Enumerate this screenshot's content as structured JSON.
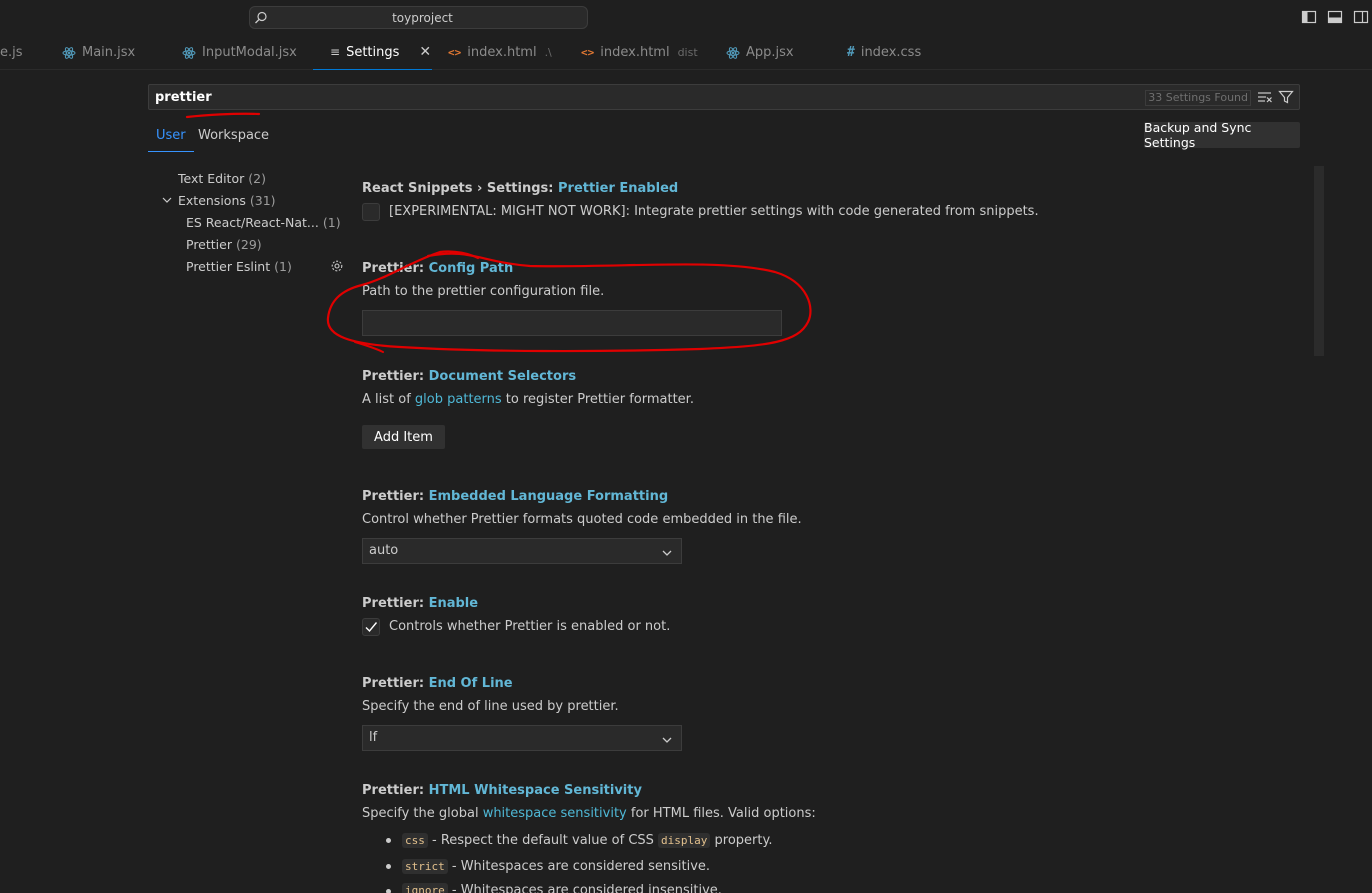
{
  "title_bar": {
    "search_label": "toyproject"
  },
  "tabs": [
    {
      "label": "e.js",
      "icon": "file-js",
      "desc": ""
    },
    {
      "label": "Main.jsx",
      "icon": "react-icon",
      "desc": ""
    },
    {
      "label": "InputModal.jsx",
      "icon": "react-icon",
      "desc": ""
    },
    {
      "label": "Settings",
      "icon": "settings-icon",
      "desc": "",
      "active": true
    },
    {
      "label": "index.html",
      "icon": "html-icon",
      "desc": ".\\"
    },
    {
      "label": "index.html",
      "icon": "html-icon",
      "desc": "dist"
    },
    {
      "label": "App.jsx",
      "icon": "react-icon",
      "desc": ""
    },
    {
      "label": "index.css",
      "icon": "css-icon",
      "desc": ""
    }
  ],
  "search": {
    "value": "prettier",
    "count": "33 Settings Found"
  },
  "scopes": {
    "user": "User",
    "workspace": "Workspace"
  },
  "sync_button": "Backup and Sync Settings",
  "toc": {
    "text_editor": {
      "label": "Text Editor",
      "count": "(2)"
    },
    "extensions": {
      "label": "Extensions",
      "count": "(31)"
    },
    "es_react": {
      "label": "ES React/React-Nat...",
      "count": "(1)"
    },
    "prettier": {
      "label": "Prettier",
      "count": "(29)"
    },
    "prettier_eslint": {
      "label": "Prettier Eslint",
      "count": "(1)"
    }
  },
  "settings": {
    "react_snippets": {
      "category": "React Snippets › Settings: ",
      "name": "Prettier Enabled",
      "label": "[EXPERIMENTAL: MIGHT NOT WORK]: Integrate prettier settings with code generated from snippets."
    },
    "config_path": {
      "category": "Prettier: ",
      "name": "Config Path",
      "desc": "Path to the prettier configuration file."
    },
    "document_selectors": {
      "category": "Prettier: ",
      "name": "Document Selectors",
      "desc_pre": "A list of ",
      "desc_link": "glob patterns",
      "desc_post": " to register Prettier formatter.",
      "button": "Add Item"
    },
    "embedded_language": {
      "category": "Prettier: ",
      "name": "Embedded Language Formatting",
      "desc": "Control whether Prettier formats quoted code embedded in the file.",
      "value": "auto"
    },
    "enable": {
      "category": "Prettier: ",
      "name": "Enable",
      "label": "Controls whether Prettier is enabled or not."
    },
    "end_of_line": {
      "category": "Prettier: ",
      "name": "End Of Line",
      "desc": "Specify the end of line used by prettier.",
      "value": "lf"
    },
    "html_whitespace": {
      "category": "Prettier: ",
      "name": "HTML Whitespace Sensitivity",
      "desc_pre": "Specify the global ",
      "desc_link": "whitespace sensitivity",
      "desc_post": " for HTML files. Valid options:",
      "options": [
        {
          "code": "css",
          "text_pre": " - Respect the default value of CSS ",
          "code2": "display",
          "text_post": " property."
        },
        {
          "code": "strict",
          "text_pre": " - Whitespaces are considered sensitive.",
          "code2": "",
          "text_post": ""
        },
        {
          "code": "ignore",
          "text_pre": " - Whitespaces are considered insensitive.",
          "code2": "",
          "text_post": ""
        }
      ]
    }
  },
  "colors": {
    "background": "#1f1f1f",
    "accent": "#3794ff",
    "link": "#4fb8d6",
    "annotation": "#e00000"
  }
}
